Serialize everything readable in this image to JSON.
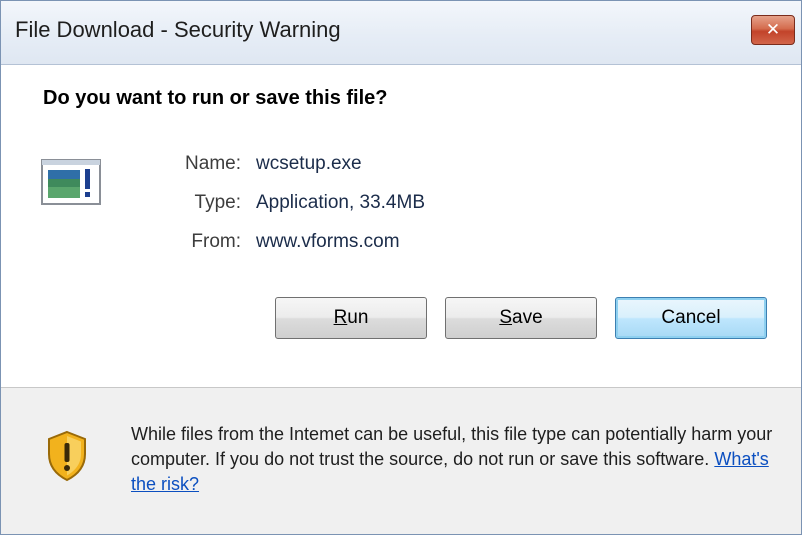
{
  "window": {
    "title": "File Download - Security Warning",
    "close_label": "✕"
  },
  "question": "Do you want to run or save this file?",
  "file": {
    "icon": "application-file-icon",
    "name_label": "Name:",
    "name_value": "wcsetup.exe",
    "type_label": "Type:",
    "type_value": "Application, 33.4MB",
    "from_label": "From:",
    "from_value": "www.vforms.com"
  },
  "buttons": {
    "run_accel": "R",
    "run_rest": "un",
    "save_accel": "S",
    "save_rest": "ave",
    "cancel": "Cancel"
  },
  "warning": {
    "icon": "shield-warning-icon",
    "text": "While files from the Intemet can be useful, this file type can potentially harm your computer. If you do not trust the source, do not run or save this software.",
    "link": "What's the risk?"
  },
  "colors": {
    "link": "#0b4fc0",
    "close_button": "#c2432a",
    "default_button": "#bee6fd",
    "shield": "#f2b21d"
  }
}
